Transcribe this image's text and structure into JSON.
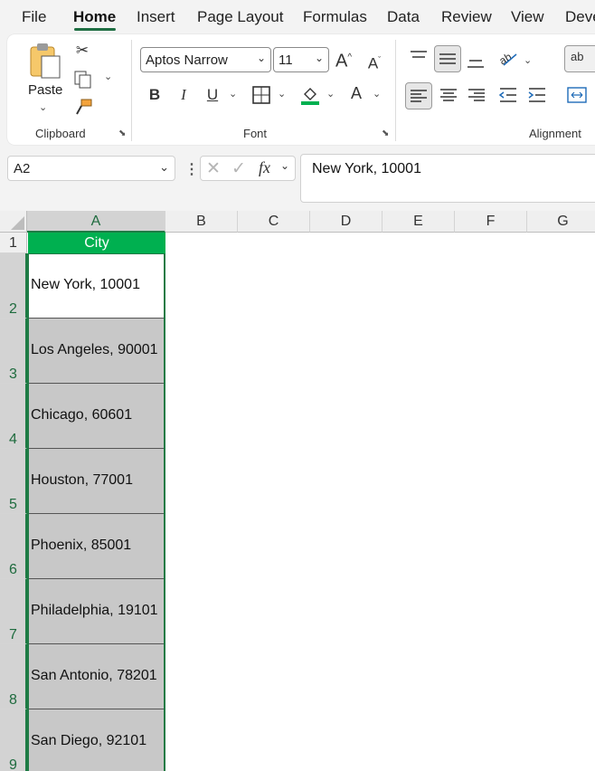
{
  "tabs": [
    "File",
    "Home",
    "Insert",
    "Page Layout",
    "Formulas",
    "Data",
    "Review",
    "View",
    "Deve"
  ],
  "active_tab": "Home",
  "ribbon": {
    "clipboard": {
      "paste_label": "Paste",
      "group_label": "Clipboard"
    },
    "font": {
      "font_name": "Aptos Narrow",
      "font_size": "11",
      "group_label": "Font",
      "fill_color": "#00b050"
    },
    "alignment": {
      "group_label": "Alignment",
      "wrap_partial": "ab"
    }
  },
  "formula_bar": {
    "name_box": "A2",
    "fx": "fx",
    "content": "New York, 10001"
  },
  "columns": [
    "A",
    "B",
    "C",
    "D",
    "E",
    "F",
    "G"
  ],
  "rows": [
    "1",
    "2",
    "3",
    "4",
    "5",
    "6",
    "7",
    "8",
    "9"
  ],
  "header_cell": "City",
  "cells": [
    "New York, 10001",
    "Los Angeles, 90001",
    "Chicago, 60601",
    "Houston, 77001",
    "Phoenix, 85001",
    "Philadelphia, 19101",
    "San Antonio, 78201",
    "San Diego, 92101"
  ],
  "colors": {
    "accent": "#1e7b45",
    "header_fill": "#00b050",
    "selected_fill": "#c8c8c8"
  }
}
